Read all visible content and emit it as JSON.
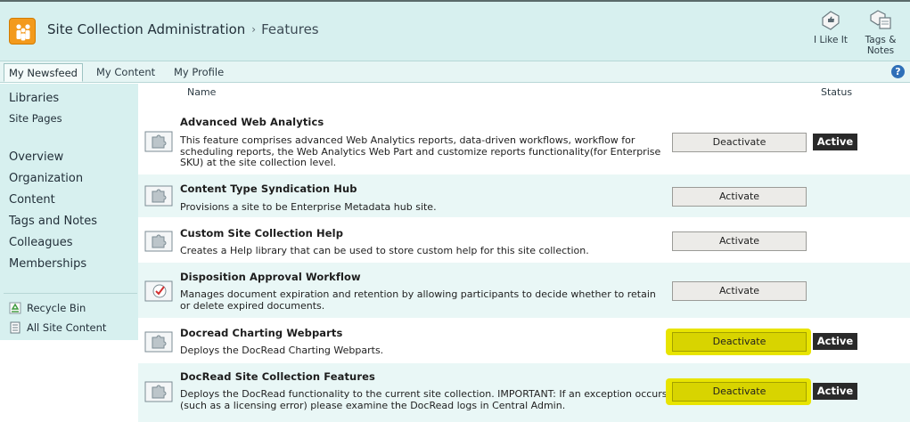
{
  "header": {
    "breadcrumb_root": "Site Collection Administration",
    "breadcrumb_separator": "›",
    "breadcrumb_current": "Features",
    "i_like_it": "I Like It",
    "tags_notes_line1": "Tags &",
    "tags_notes_line2": "Notes"
  },
  "topnav": {
    "tabs": [
      {
        "label": "My Newsfeed",
        "selected": true
      },
      {
        "label": "My Content",
        "selected": false
      },
      {
        "label": "My Profile",
        "selected": false
      }
    ],
    "help": "?"
  },
  "leftnav": {
    "libraries": "Libraries",
    "site_pages": "Site Pages",
    "items": [
      "Overview",
      "Organization",
      "Content",
      "Tags and Notes",
      "Colleagues",
      "Memberships"
    ],
    "recycle_bin": "Recycle Bin",
    "all_site_content": "All Site Content"
  },
  "columns": {
    "name": "Name",
    "status": "Status"
  },
  "features": [
    {
      "title": "Advanced Web Analytics",
      "description": "This feature comprises advanced Web Analytics reports, data-driven workflows, workflow for scheduling reports, the Web Analytics Web Part and customize reports functionality(for Enterprise SKU) at the site collection level.",
      "button": "Deactivate",
      "status": "Active",
      "highlighted": false
    },
    {
      "title": "Content Type Syndication Hub",
      "description": "Provisions a site to be Enterprise Metadata hub site.",
      "button": "Activate",
      "status": "",
      "highlighted": false
    },
    {
      "title": "Custom Site Collection Help",
      "description": "Creates a Help library that can be used to store custom help for this site collection.",
      "button": "Activate",
      "status": "",
      "highlighted": false
    },
    {
      "title": "Disposition Approval Workflow",
      "description": "Manages document expiration and retention by allowing participants to decide whether to retain or delete expired documents.",
      "button": "Activate",
      "status": "",
      "highlighted": false
    },
    {
      "title": "Docread Charting Webparts",
      "description": "Deploys the DocRead Charting Webparts.",
      "button": "Deactivate",
      "status": "Active",
      "highlighted": true
    },
    {
      "title": "DocRead Site Collection Features",
      "description": "Deploys the DocRead functionality to the current site collection. IMPORTANT: If an exception occurs (such as a licensing error) please examine the DocRead logs in Central Admin.",
      "button": "Deactivate",
      "status": "Active",
      "highlighted": true
    }
  ],
  "colors": {
    "header_bg": "#d7f0ef",
    "alt_row_bg": "#e9f7f6",
    "highlight": "#d8d400",
    "status_bg": "#2a2a2a",
    "logo_orange": "#f39a1c"
  },
  "icons": {
    "site_logo": "people-logo-icon",
    "i_like_it": "thumbs-up-tag-icon",
    "tags_notes": "tag-note-icon",
    "feature": "puzzle-piece-icon",
    "workflow_feature": "checkmark-clock-icon",
    "recycle_bin": "recycle-icon",
    "all_site_content": "document-list-icon"
  }
}
